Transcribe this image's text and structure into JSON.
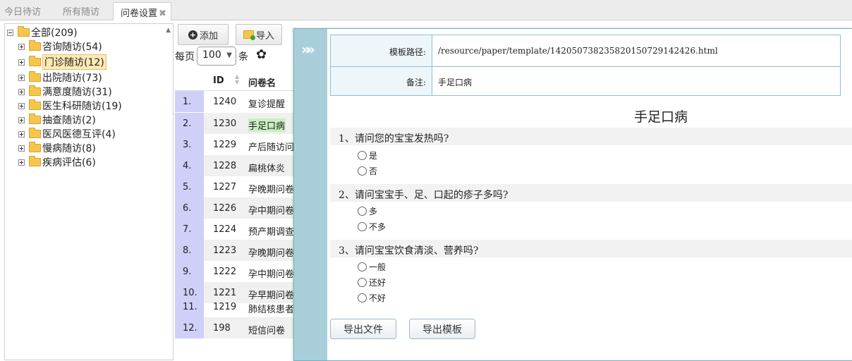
{
  "tabs": [
    {
      "label": "今日待访",
      "active": false
    },
    {
      "label": "所有随访",
      "active": false
    },
    {
      "label": "问卷设置",
      "active": true
    }
  ],
  "tab_close_glyph": "✖",
  "tree": {
    "root": "全部(209)",
    "children": [
      "咨询随访(54)",
      "门诊随访(12)",
      "出院随访(73)",
      "满意度随访(31)",
      "医生科研随访(19)",
      "抽查随访(2)",
      "医风医德互评(4)",
      "慢病随访(8)",
      "疾病评估(6)"
    ],
    "selected": "门诊随访(12)"
  },
  "toolbar": {
    "add_label": "添加",
    "import_label": "导入"
  },
  "pagination": {
    "per_page_label": "每页",
    "page_size": "100",
    "unit": "条"
  },
  "table": {
    "headers": {
      "id": "ID",
      "name": "问卷名"
    },
    "rows": [
      {
        "num": "1.",
        "id": "1240",
        "name": "复诊提醒"
      },
      {
        "num": "2.",
        "id": "1230",
        "name": "手足口病"
      },
      {
        "num": "3.",
        "id": "1229",
        "name": "产后随访问"
      },
      {
        "num": "4.",
        "id": "1228",
        "name": "扁桃体炎"
      },
      {
        "num": "5.",
        "id": "1227",
        "name": "孕晚期问卷"
      },
      {
        "num": "6.",
        "id": "1226",
        "name": "孕中期问卷"
      },
      {
        "num": "7.",
        "id": "1224",
        "name": "预产期调查"
      },
      {
        "num": "8.",
        "id": "1223",
        "name": "孕晚期问卷"
      },
      {
        "num": "9.",
        "id": "1222",
        "name": "孕中期问卷"
      },
      {
        "num": "10.",
        "id": "1221",
        "name": "孕早期问卷"
      },
      {
        "num": "11.",
        "id": "1219",
        "name": "肺结核患者"
      },
      {
        "num": "12.",
        "id": "198",
        "name": "短信问卷"
      }
    ],
    "highlighted_row": 1
  },
  "dialog": {
    "template_path_label": "模板路径:",
    "template_path": "/resource/paper/template/1420507382358201507291424​26.html",
    "note_label": "备注:",
    "note": "手足口病",
    "form_title": "手足口病",
    "questions": [
      {
        "text": "1、请问您的宝宝发热吗?",
        "options": [
          "是",
          "否"
        ]
      },
      {
        "text": "2、请问宝宝手、足、口起的疹子多吗?",
        "options": [
          "多",
          "不多"
        ]
      },
      {
        "text": "3、请问宝宝饮食清淡、营养吗?",
        "options": [
          "一般",
          "还好",
          "不好"
        ]
      }
    ],
    "export_file_label": "导出文件",
    "export_template_label": "导出模板"
  },
  "colors": {
    "row_number_bg": "#cfcff8",
    "dialog_side": "#a8cfd9",
    "highlight": "#c8f0c0",
    "folder": "#f6c64c"
  }
}
